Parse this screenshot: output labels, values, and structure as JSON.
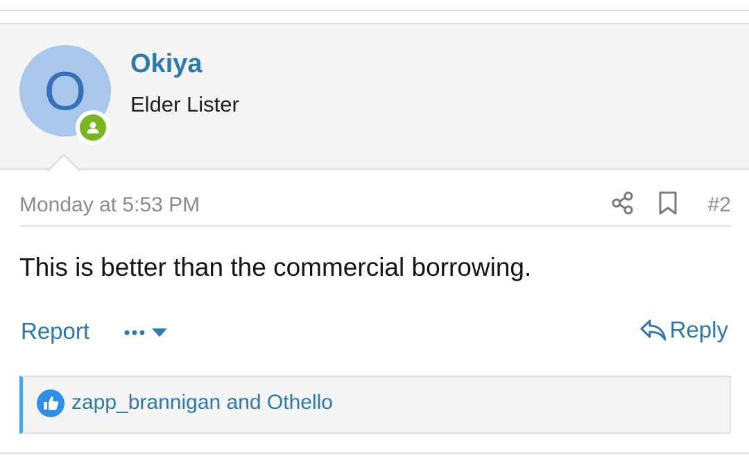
{
  "user": {
    "avatar_letter": "O",
    "name": "Okiya",
    "title": "Elder Lister",
    "status_icon": "online-user-icon"
  },
  "post": {
    "date": "Monday at 5:53 PM",
    "number": "#2",
    "message": "This is better than the commercial borrowing."
  },
  "actions": {
    "report": "Report",
    "more_icon": "ellipsis-dropdown-icon",
    "reply": "Reply",
    "share_icon": "share-icon",
    "bookmark_icon": "bookmark-icon"
  },
  "reactions": {
    "icon": "thumbs-up-icon",
    "users_text": "zapp_brannigan and Othello"
  },
  "colors": {
    "link": "#2d78b0",
    "avatar_bg": "#a9c7ea",
    "avatar_letter": "#3671b8",
    "online": "#7bb51e",
    "like": "#2f8fe8",
    "reaction_bar_accent": "#47a7eb"
  }
}
